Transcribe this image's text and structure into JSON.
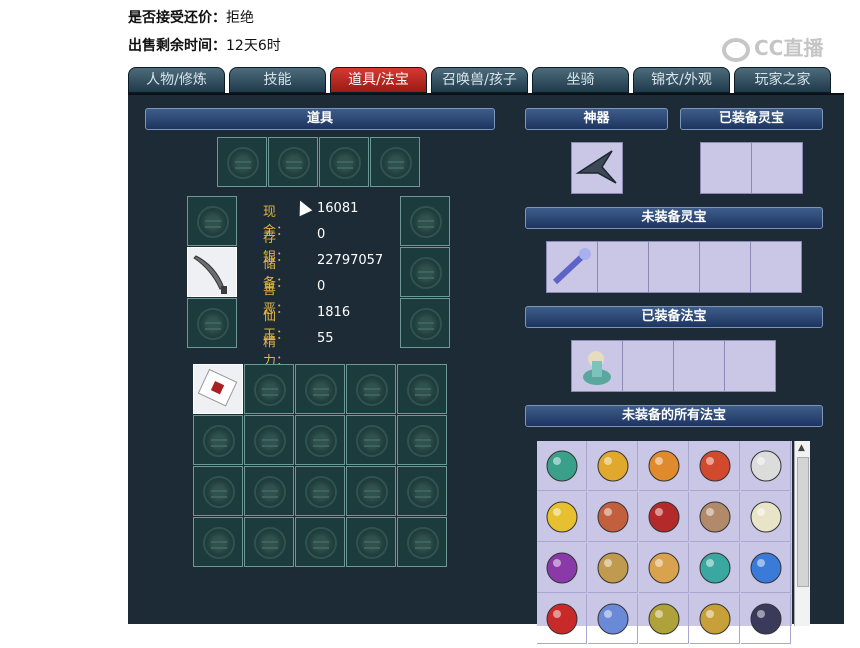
{
  "info": {
    "counter_offer_label": "是否接受还价：",
    "counter_offer_value": "拒绝",
    "time_left_label": "出售剩余时间：",
    "time_left_value": "12天6时"
  },
  "watermark": "CC直播",
  "tabs": [
    "人物/修炼",
    "技能",
    "道具/法宝",
    "召唤兽/孩子",
    "坐骑",
    "锦衣/外观",
    "玩家之家"
  ],
  "active_tab": "道具/法宝",
  "sections": {
    "items": "道具",
    "artifact": "神器",
    "equipped_spirit": "已装备灵宝",
    "unequipped_spirit": "未装备灵宝",
    "equipped_magic": "已装备法宝",
    "all_unequipped_magic": "未装备的所有法宝"
  },
  "stats": [
    {
      "label": "现金：",
      "value": "16081"
    },
    {
      "label": "存银：",
      "value": "0"
    },
    {
      "label": "储备：",
      "value": "22797057"
    },
    {
      "label": "善恶：",
      "value": "0"
    },
    {
      "label": "仙玉：",
      "value": "1816"
    },
    {
      "label": "精力：",
      "value": "55"
    }
  ],
  "icons": {
    "slot_emblem": "bronze-coin-emblem",
    "artifact": "dark-blade-artifact",
    "weapon": "curved-dagger",
    "bag_item": "red-talisman-card",
    "spirit": "blue-crystal-staff",
    "magic": "jade-figure-statue"
  },
  "magic_items": [
    "green-dragon-icon",
    "golden-gourd-icon",
    "orange-banner-icon",
    "pagoda-icon",
    "white-cloud-icon",
    "gold-ingot-icon",
    "bronze-bell-icon",
    "opera-mask-icon",
    "meditating-monk-icon",
    "paper-doll-icon",
    "purple-ghost-icon",
    "hand-mirror-icon",
    "scroll-icon",
    "lotus-icon",
    "blue-orb-icon",
    "red-sword-icon",
    "blue-fan-icon",
    "gold-token-icon",
    "gold-bell-icon",
    "dark-box-icon"
  ],
  "colors": {
    "panel": "#1c2b36",
    "active_tab": "#c42a22",
    "stat_label": "#e2b53c",
    "lavender": "#c9c6e6"
  }
}
